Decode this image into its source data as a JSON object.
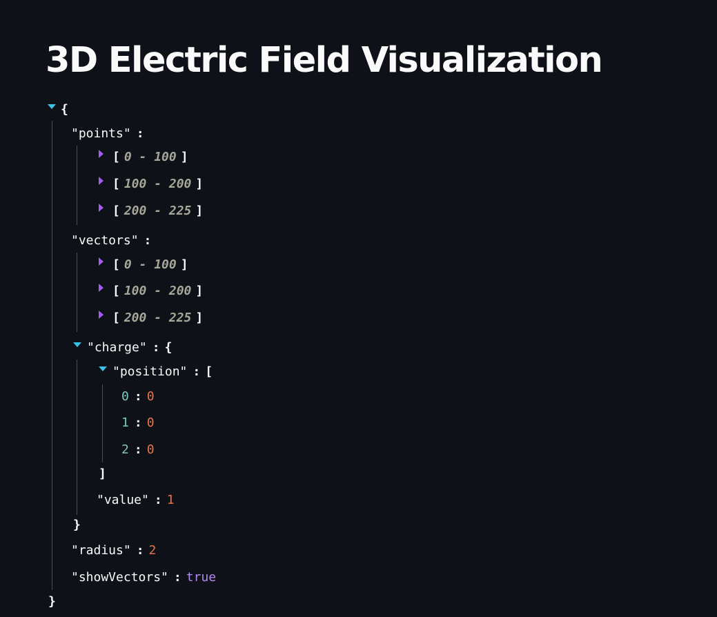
{
  "page": {
    "title": "3D Electric Field Visualization"
  },
  "json_viewer": {
    "root_open": "{",
    "root_close": "}",
    "colon": ":",
    "points": {
      "key": "\"points\"",
      "chunks": [
        {
          "open": "[",
          "range": "0 - 100",
          "close": "]"
        },
        {
          "open": "[",
          "range": "100 - 200",
          "close": "]"
        },
        {
          "open": "[",
          "range": "200 - 225",
          "close": "]"
        }
      ]
    },
    "vectors": {
      "key": "\"vectors\"",
      "chunks": [
        {
          "open": "[",
          "range": "0 - 100",
          "close": "]"
        },
        {
          "open": "[",
          "range": "100 - 200",
          "close": "]"
        },
        {
          "open": "[",
          "range": "200 - 225",
          "close": "]"
        }
      ]
    },
    "charge": {
      "key": "\"charge\"",
      "open": "{",
      "close": "}",
      "position": {
        "key": "\"position\"",
        "open": "[",
        "close": "]",
        "items": [
          {
            "index": "0",
            "value": "0"
          },
          {
            "index": "1",
            "value": "0"
          },
          {
            "index": "2",
            "value": "0"
          }
        ]
      },
      "value": {
        "key": "\"value\"",
        "value": "1"
      }
    },
    "radius": {
      "key": "\"radius\"",
      "value": "2"
    },
    "showVectors": {
      "key": "\"showVectors\"",
      "value": "true"
    }
  },
  "colors": {
    "background": "#0e1117",
    "text": "#fafafa",
    "number": "#e9744a",
    "boolean": "#b28cf0",
    "index": "#7fc8c0",
    "range": "#a8a89a",
    "expanded_arrow": "#3cc1e6",
    "collapsed_arrow": "#a35cf0",
    "guide_line": "#4a4d55"
  }
}
